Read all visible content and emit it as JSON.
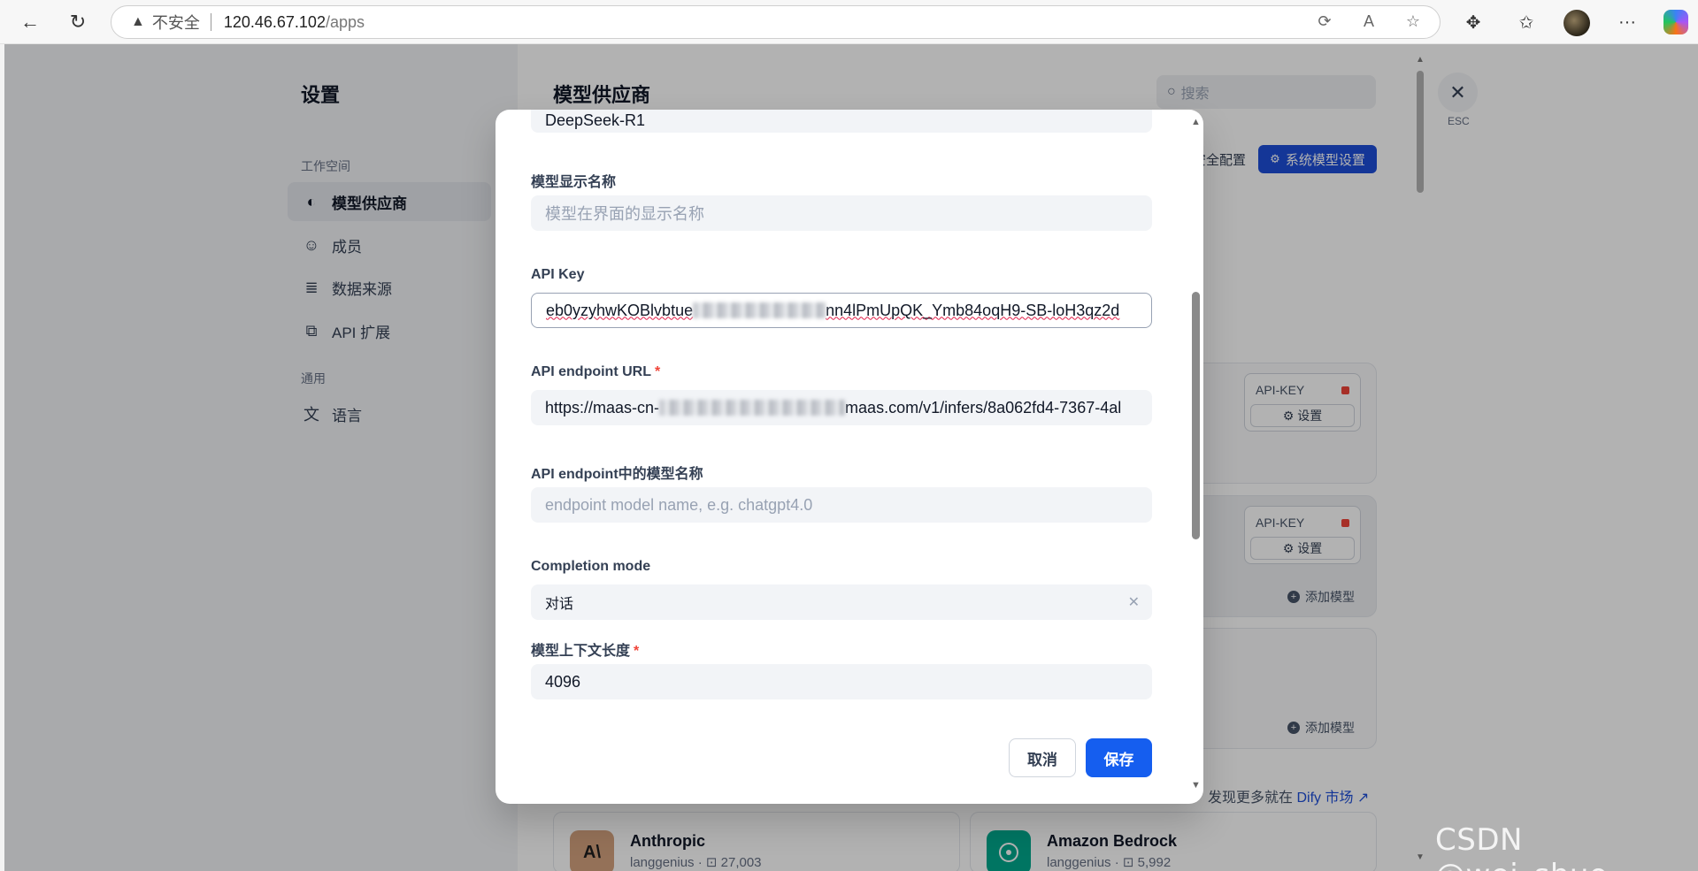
{
  "browser": {
    "security_warning": "不安全",
    "url_host": "120.46.67.102",
    "url_path": "/apps",
    "icons": [
      "back-icon",
      "refresh-icon",
      "warning-icon",
      "edge-sync-icon",
      "read-aloud-icon",
      "favorite-star-icon",
      "extensions-icon",
      "favorites-icon",
      "profile-avatar",
      "more-icon",
      "copilot-icon"
    ]
  },
  "settings": {
    "title": "设置",
    "workspace_label": "工作空间",
    "general_label": "通用",
    "items": [
      {
        "label": "模型供应商",
        "icon": "brain-icon",
        "active": true
      },
      {
        "label": "成员",
        "icon": "members-icon",
        "active": false
      },
      {
        "label": "数据来源",
        "icon": "database-icon",
        "active": false
      },
      {
        "label": "API 扩展",
        "icon": "puzzle-icon",
        "active": false
      }
    ],
    "general_items": [
      {
        "label": "语言",
        "icon": "translate-icon"
      }
    ]
  },
  "providers": {
    "title": "模型供应商",
    "search_placeholder": "搜索",
    "security_config_label": "安全配置",
    "system_model_settings_label": "系统模型设置",
    "esc_label": "ESC",
    "api_key_label": "API-KEY",
    "set_label": "设置",
    "add_model_label": "添加模型",
    "market_text": "发现更多就在",
    "market_link": "Dify 市场 ↗",
    "plugins": [
      {
        "name": "Anthropic",
        "author": "langgenius",
        "installs": "27,003",
        "logo_text": "A\\"
      },
      {
        "name": "Amazon Bedrock",
        "author": "langgenius",
        "installs": "5,992",
        "logo_text": ""
      }
    ]
  },
  "modal": {
    "top_value": "DeepSeek-R1",
    "display_name": {
      "label": "模型显示名称",
      "placeholder": "模型在界面的显示名称",
      "value": ""
    },
    "api_key": {
      "label": "API Key",
      "value_start": "eb0yzyhwKOBlvbtue",
      "value_end": "nn4lPmUpQK_Ymb84oqH9-SB-loH3qz2d"
    },
    "endpoint_url": {
      "label": "API endpoint URL",
      "required": "*",
      "value_start": "https://maas-cn-",
      "value_end": "maas.com/v1/infers/8a062fd4-7367-4al"
    },
    "endpoint_model": {
      "label": "API endpoint中的模型名称",
      "placeholder": "endpoint model name, e.g. chatgpt4.0",
      "value": ""
    },
    "completion_mode": {
      "label": "Completion mode",
      "value": "对话"
    },
    "context_length": {
      "label": "模型上下文长度",
      "required": "*",
      "value": "4096"
    },
    "cancel_label": "取消",
    "save_label": "保存"
  },
  "watermark": "CSDN @wei_shuo"
}
